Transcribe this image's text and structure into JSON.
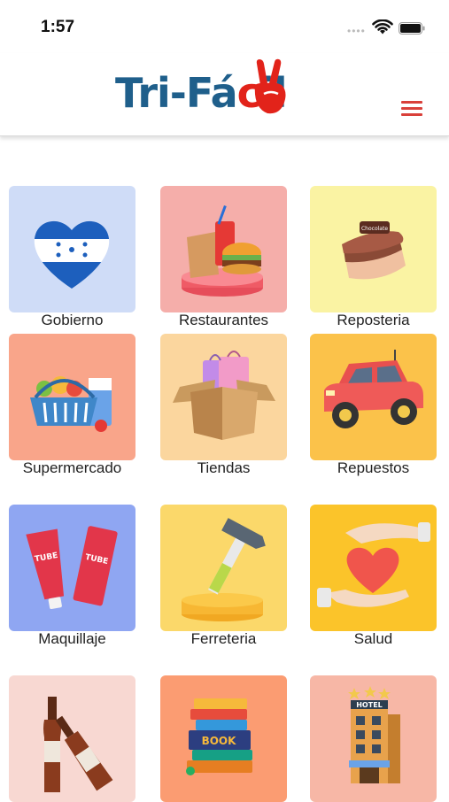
{
  "status_bar": {
    "time": "1:57"
  },
  "header": {
    "logo_text_blue": "Tri-Fá",
    "logo_text_red": "c",
    "logo_text_end": "il"
  },
  "categories": [
    {
      "label": "Gobierno",
      "bg": "#cfdcf7",
      "icon": "honduras-heart-icon"
    },
    {
      "label": "Restaurantes",
      "bg": "#f5aeaa",
      "icon": "fast-food-icon"
    },
    {
      "label": "Reposteria",
      "bg": "#faf3a3",
      "icon": "cake-icon"
    },
    {
      "label": "Supermercado",
      "bg": "#f9a58a",
      "icon": "grocery-basket-icon"
    },
    {
      "label": "Tiendas",
      "bg": "#fbd69e",
      "icon": "shopping-box-icon"
    },
    {
      "label": "Repuestos",
      "bg": "#fbc24a",
      "icon": "toy-car-icon"
    },
    {
      "label": "Maquillaje",
      "bg": "#8fa6f2",
      "icon": "cosmetic-tube-icon"
    },
    {
      "label": "Ferreteria",
      "bg": "#fbd86a",
      "icon": "hammer-icon"
    },
    {
      "label": "Salud",
      "bg": "#fbc42a",
      "icon": "heart-hands-icon"
    },
    {
      "label": "",
      "bg": "#f8d8d2",
      "icon": "wine-bottles-icon"
    },
    {
      "label": "",
      "bg": "#fb9c72",
      "icon": "books-icon"
    },
    {
      "label": "",
      "bg": "#f7b7a6",
      "icon": "hotel-icon"
    }
  ],
  "icons_text": {
    "hotel_sign": "HOTEL",
    "book_sign": "BOOK",
    "tube_text": "TUBE",
    "cake_sign": "Chocolate"
  }
}
